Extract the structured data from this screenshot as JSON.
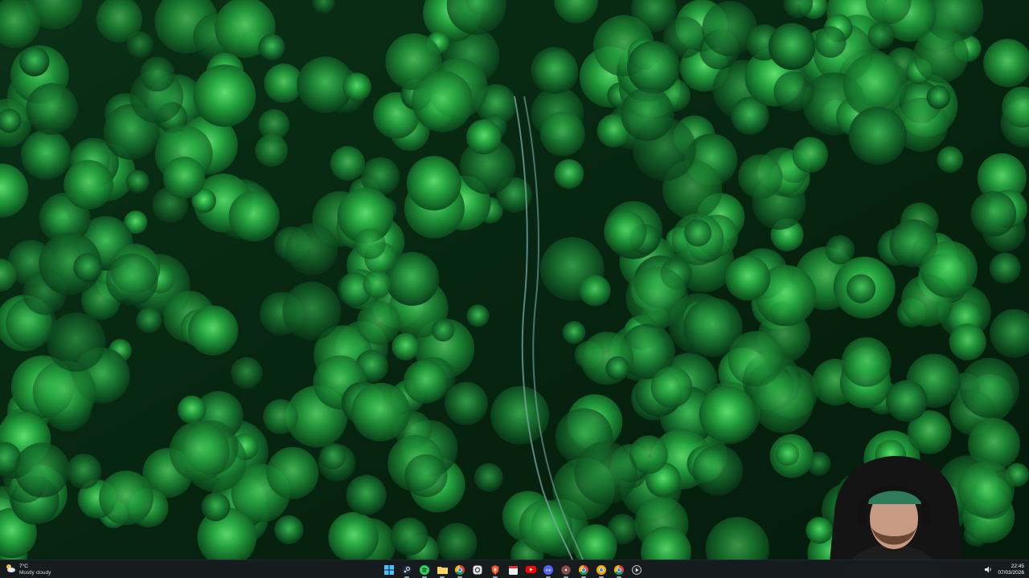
{
  "desktop": {
    "wallpaper": "aerial-forest-with-dirt-road",
    "webcam_overlay": "streamer-webcam"
  },
  "taskbar": {
    "weather": {
      "temperature": "7°C",
      "condition": "Mostly cloudy",
      "icon": "cloud-sun-icon"
    },
    "apps": [
      {
        "name": "Start",
        "icon": "windows-start-icon"
      },
      {
        "name": "Steam",
        "icon": "steam-icon"
      },
      {
        "name": "Spotify",
        "icon": "spotify-icon"
      },
      {
        "name": "File Explorer",
        "icon": "folder-icon"
      },
      {
        "name": "Google Chrome",
        "icon": "chrome-icon"
      },
      {
        "name": "App",
        "icon": "app-icon"
      },
      {
        "name": "Brave",
        "icon": "brave-icon"
      },
      {
        "name": "Calendar",
        "icon": "calendar-icon"
      },
      {
        "name": "YouTube",
        "icon": "youtube-icon"
      },
      {
        "name": "Discord",
        "icon": "discord-icon"
      },
      {
        "name": "Chrome Profile",
        "icon": "chrome-profile-icon"
      },
      {
        "name": "Google Chrome 2",
        "icon": "chrome-icon"
      },
      {
        "name": "Chrome Canary",
        "icon": "chrome-canary-icon"
      },
      {
        "name": "Google Chrome 3",
        "icon": "chrome-icon"
      },
      {
        "name": "Media Player",
        "icon": "play-icon"
      }
    ],
    "clock": {
      "time": "22:45",
      "date": "07/03/2026"
    },
    "colors": {
      "taskbar_bg": "#181c20",
      "forest_dark": "#06240f",
      "forest_light": "#2fbf4a",
      "road": "#7aa8a0"
    }
  }
}
